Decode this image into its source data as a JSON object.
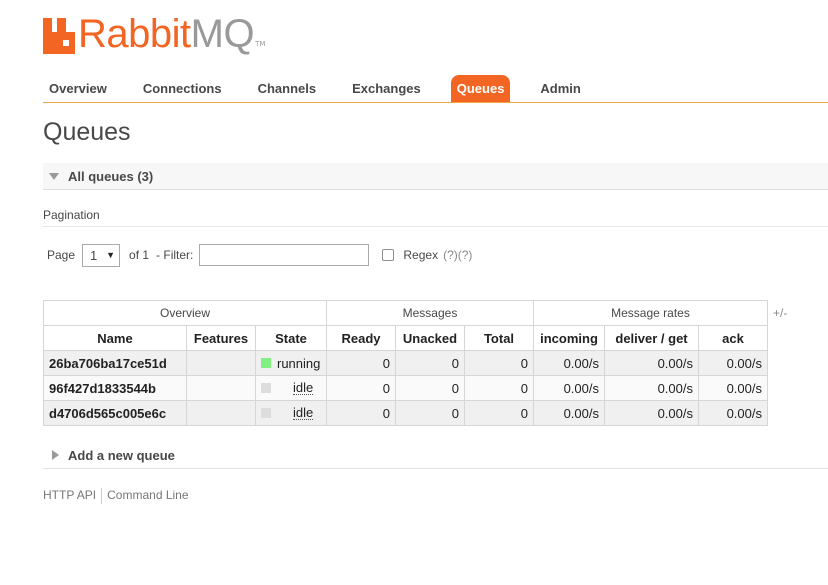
{
  "logo": {
    "rabbit": "Rabbit",
    "mq": "MQ",
    "tm": "TM"
  },
  "nav": [
    {
      "label": "Overview",
      "active": false
    },
    {
      "label": "Connections",
      "active": false
    },
    {
      "label": "Channels",
      "active": false
    },
    {
      "label": "Exchanges",
      "active": false
    },
    {
      "label": "Queues",
      "active": true
    },
    {
      "label": "Admin",
      "active": false
    }
  ],
  "page_title": "Queues",
  "all_queues_label": "All queues (3)",
  "pagination": {
    "label": "Pagination",
    "page_label": "Page",
    "page_value": "1",
    "of_label": "of 1",
    "filter_label": "- Filter:",
    "filter_value": "",
    "regex_label": "Regex",
    "help1": "(?)",
    "help2": "(?)"
  },
  "table": {
    "groups": [
      "Overview",
      "Messages",
      "Message rates"
    ],
    "columns": [
      "Name",
      "Features",
      "State",
      "Ready",
      "Unacked",
      "Total",
      "incoming",
      "deliver / get",
      "ack"
    ],
    "rows": [
      {
        "name": "26ba706ba17ce51d",
        "features": "",
        "state": "running",
        "state_color": "#80f080",
        "ready": "0",
        "unacked": "0",
        "total": "0",
        "incoming": "0.00/s",
        "deliver_get": "0.00/s",
        "ack": "0.00/s"
      },
      {
        "name": "96f427d1833544b",
        "features": "",
        "state": "idle",
        "state_color": "#dddddd",
        "ready": "0",
        "unacked": "0",
        "total": "0",
        "incoming": "0.00/s",
        "deliver_get": "0.00/s",
        "ack": "0.00/s"
      },
      {
        "name": "d4706d565c005e6c",
        "features": "",
        "state": "idle",
        "state_color": "#dddddd",
        "ready": "0",
        "unacked": "0",
        "total": "0",
        "incoming": "0.00/s",
        "deliver_get": "0.00/s",
        "ack": "0.00/s"
      }
    ],
    "plus_minus": "+/-"
  },
  "add_queue_label": "Add a new queue",
  "footer": {
    "http_api": "HTTP API",
    "command_line": "Command Line"
  },
  "colors": {
    "accent": "#f26522",
    "nav_border": "#f2a541",
    "running": "#80f080",
    "idle": "#dddddd"
  }
}
